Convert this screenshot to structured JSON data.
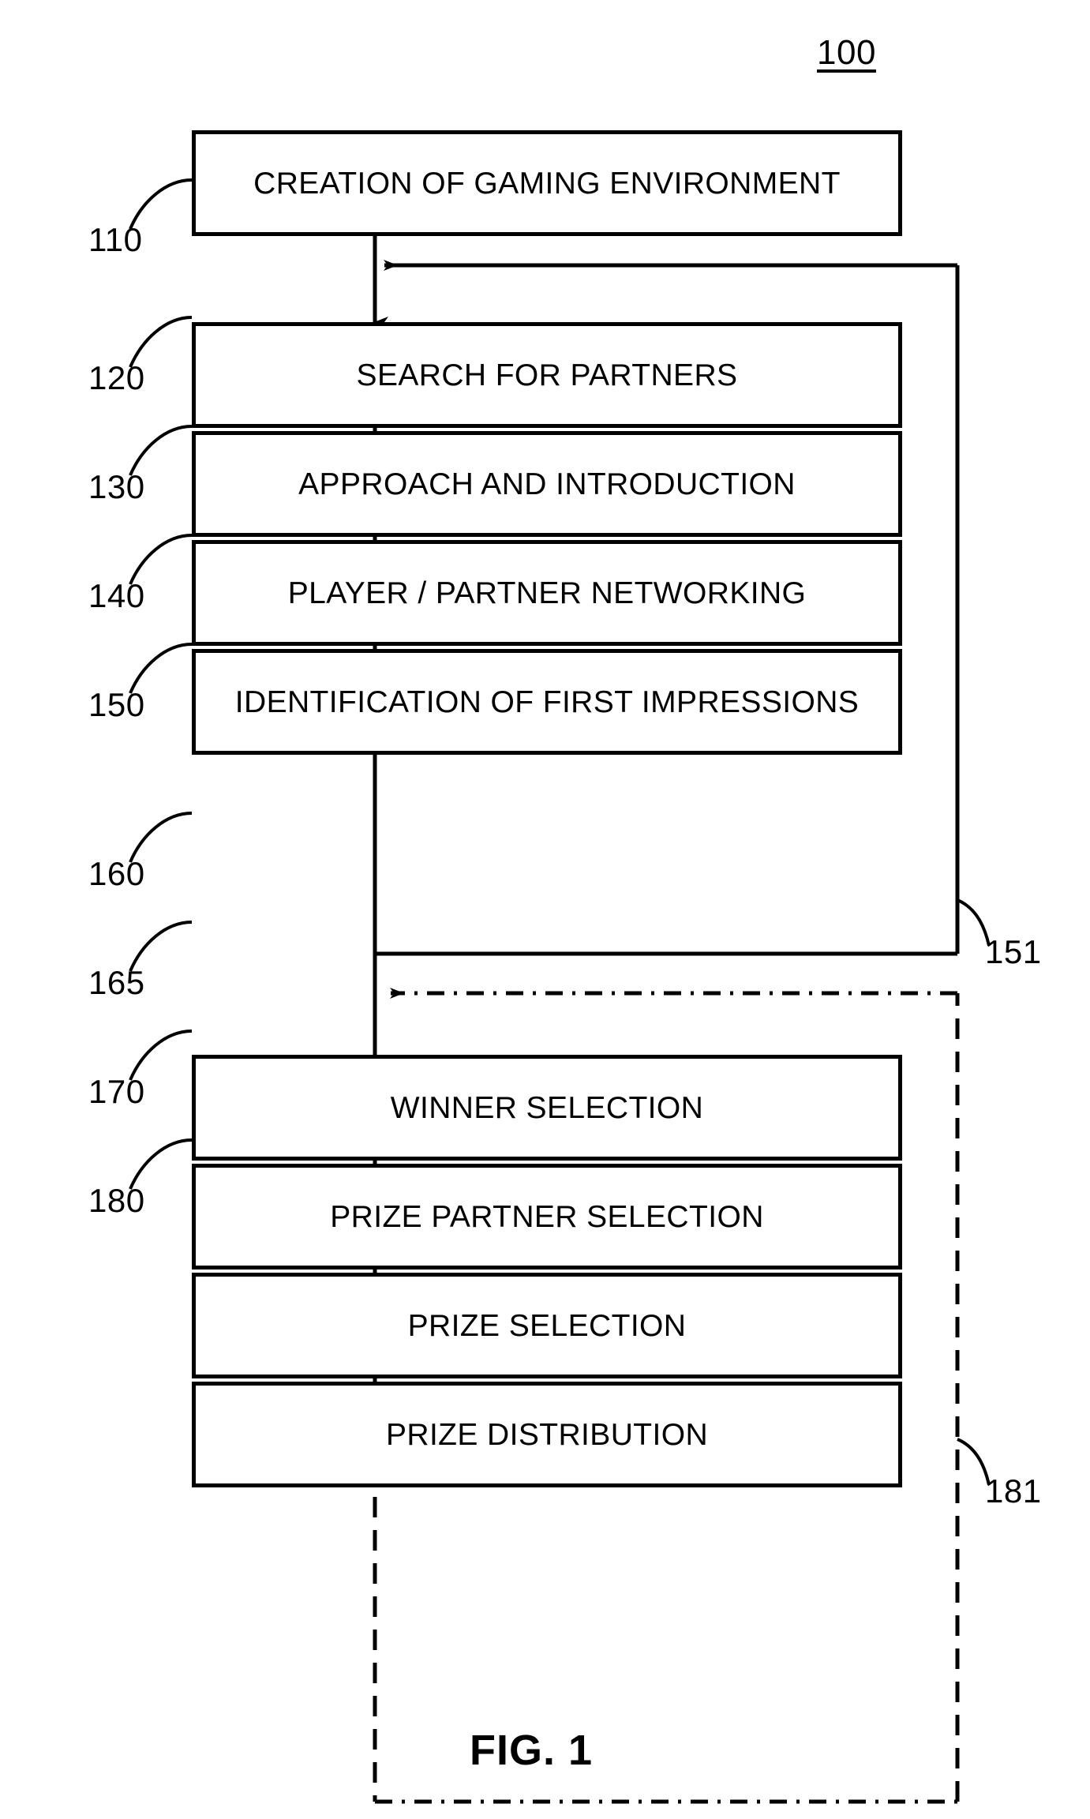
{
  "figure": {
    "reference_number": "100",
    "caption": "FIG. 1"
  },
  "boxes": [
    {
      "id": "110",
      "label": "CREATION OF GAMING ENVIRONMENT",
      "ref": "110"
    },
    {
      "id": "120",
      "label": "SEARCH FOR PARTNERS",
      "ref": "120"
    },
    {
      "id": "130",
      "label": "APPROACH AND INTRODUCTION",
      "ref": "130"
    },
    {
      "id": "140",
      "label": "PLAYER / PARTNER NETWORKING",
      "ref": "140"
    },
    {
      "id": "150",
      "label": "IDENTIFICATION OF FIRST IMPRESSIONS",
      "ref": "150"
    },
    {
      "id": "160",
      "label": "WINNER SELECTION",
      "ref": "160"
    },
    {
      "id": "165",
      "label": "PRIZE PARTNER SELECTION",
      "ref": "165"
    },
    {
      "id": "170",
      "label": "PRIZE SELECTION",
      "ref": "170"
    },
    {
      "id": "180",
      "label": "PRIZE DISTRIBUTION",
      "ref": "180"
    }
  ],
  "feedback_loops": [
    {
      "id": "151",
      "ref": "151",
      "style": "solid",
      "from": "150",
      "to": "120"
    },
    {
      "id": "181",
      "ref": "181",
      "style": "dash-dot",
      "from": "180",
      "to": "160"
    }
  ],
  "colors": {
    "line": "#000000",
    "background": "#ffffff"
  }
}
